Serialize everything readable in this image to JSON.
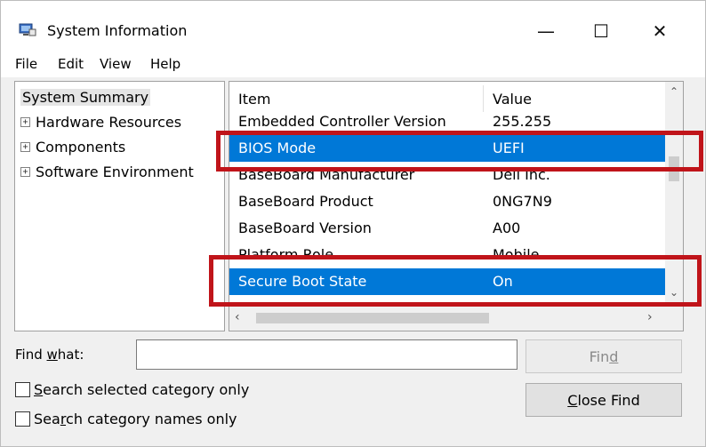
{
  "window": {
    "title": "System Information",
    "controls": {
      "minimize": "—",
      "maximize": "☐",
      "close": "✕"
    }
  },
  "menu": [
    "File",
    "Edit",
    "View",
    "Help"
  ],
  "tree": {
    "root": "System Summary",
    "items": [
      {
        "label": "Hardware Resources",
        "expander": "+"
      },
      {
        "label": "Components",
        "expander": "+"
      },
      {
        "label": "Software Environment",
        "expander": "+"
      }
    ]
  },
  "list": {
    "headers": {
      "item": "Item",
      "value": "Value"
    },
    "rows": [
      {
        "item": "Embedded Controller Version",
        "value": "255.255",
        "selected": false
      },
      {
        "item": "BIOS Mode",
        "value": "UEFI",
        "selected": true
      },
      {
        "item": "BaseBoard Manufacturer",
        "value": "Dell Inc.",
        "selected": false
      },
      {
        "item": "BaseBoard Product",
        "value": "0NG7N9",
        "selected": false
      },
      {
        "item": "BaseBoard Version",
        "value": "A00",
        "selected": false
      },
      {
        "item": "Platform Role",
        "value": "Mobile",
        "selected": false
      },
      {
        "item": "Secure Boot State",
        "value": "On",
        "selected": true
      }
    ]
  },
  "find": {
    "label_pre": "Find ",
    "label_acc": "w",
    "label_post": "hat:",
    "value": "",
    "find_pre": "Fin",
    "find_acc": "d",
    "find_post": "",
    "close_pre": "",
    "close_acc": "C",
    "close_post": "lose Find",
    "opt1_pre": "",
    "opt1_acc": "S",
    "opt1_post": "earch selected category only",
    "opt2_pre": "Sea",
    "opt2_acc": "r",
    "opt2_post": "ch category names only"
  },
  "colors": {
    "selection": "#0078d7",
    "highlight_box": "#c0141a"
  }
}
